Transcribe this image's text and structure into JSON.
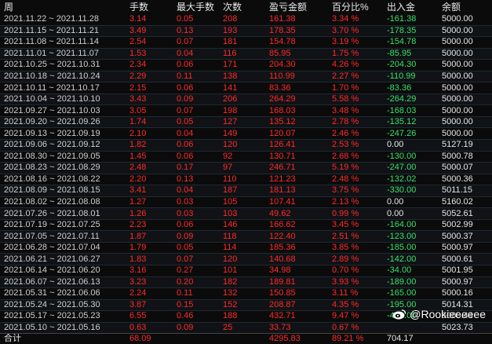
{
  "header": {
    "period": "周",
    "lots": "手数",
    "max_lots": "最大手数",
    "trades": "次数",
    "pnl": "盈亏金额",
    "pct": "百分比%",
    "flow": "出入金",
    "balance": "余额"
  },
  "rows": [
    {
      "period": "2021.11.22 ~ 2021.11.28",
      "lots": "3.14",
      "max_lots": "0.05",
      "trades": "208",
      "pnl": "161.38",
      "pct": "3.34 %",
      "flow": "-161.38",
      "balance": "5000.00"
    },
    {
      "period": "2021.11.15 ~ 2021.11.21",
      "lots": "3.49",
      "max_lots": "0.13",
      "trades": "193",
      "pnl": "178.35",
      "pct": "3.70 %",
      "flow": "-178.35",
      "balance": "5000.00"
    },
    {
      "period": "2021.11.08 ~ 2021.11.14",
      "lots": "2.54",
      "max_lots": "0.07",
      "trades": "181",
      "pnl": "154.78",
      "pct": "3.19 %",
      "flow": "-154.78",
      "balance": "5000.00"
    },
    {
      "period": "2021.11.01 ~ 2021.11.07",
      "lots": "1.53",
      "max_lots": "0.04",
      "trades": "116",
      "pnl": "85.95",
      "pct": "1.75 %",
      "flow": "-85.95",
      "balance": "5000.00"
    },
    {
      "period": "2021.10.25 ~ 2021.10.31",
      "lots": "2.34",
      "max_lots": "0.06",
      "trades": "171",
      "pnl": "204.30",
      "pct": "4.26 %",
      "flow": "-204.30",
      "balance": "5000.00"
    },
    {
      "period": "2021.10.18 ~ 2021.10.24",
      "lots": "2.29",
      "max_lots": "0.11",
      "trades": "138",
      "pnl": "110.99",
      "pct": "2.27 %",
      "flow": "-110.99",
      "balance": "5000.00"
    },
    {
      "period": "2021.10.11 ~ 2021.10.17",
      "lots": "2.15",
      "max_lots": "0.06",
      "trades": "141",
      "pnl": "83.36",
      "pct": "1.70 %",
      "flow": "-83.36",
      "balance": "5000.00"
    },
    {
      "period": "2021.10.04 ~ 2021.10.10",
      "lots": "3.43",
      "max_lots": "0.09",
      "trades": "206",
      "pnl": "264.29",
      "pct": "5.58 %",
      "flow": "-264.29",
      "balance": "5000.00"
    },
    {
      "period": "2021.09.27 ~ 2021.10.03",
      "lots": "3.05",
      "max_lots": "0.07",
      "trades": "198",
      "pnl": "168.03",
      "pct": "3.48 %",
      "flow": "-168.03",
      "balance": "5000.00"
    },
    {
      "period": "2021.09.20 ~ 2021.09.26",
      "lots": "1.74",
      "max_lots": "0.05",
      "trades": "127",
      "pnl": "135.12",
      "pct": "2.78 %",
      "flow": "-135.12",
      "balance": "5000.00"
    },
    {
      "period": "2021.09.13 ~ 2021.09.19",
      "lots": "2.10",
      "max_lots": "0.04",
      "trades": "149",
      "pnl": "120.07",
      "pct": "2.46 %",
      "flow": "-247.26",
      "balance": "5000.00"
    },
    {
      "period": "2021.09.06 ~ 2021.09.12",
      "lots": "1.82",
      "max_lots": "0.06",
      "trades": "120",
      "pnl": "126.41",
      "pct": "2.53 %",
      "flow": "0.00",
      "balance": "5127.19"
    },
    {
      "period": "2021.08.30 ~ 2021.09.05",
      "lots": "1.45",
      "max_lots": "0.06",
      "trades": "92",
      "pnl": "130.71",
      "pct": "2.68 %",
      "flow": "-130.00",
      "balance": "5000.78"
    },
    {
      "period": "2021.08.23 ~ 2021.08.29",
      "lots": "2.48",
      "max_lots": "0.17",
      "trades": "97",
      "pnl": "246.71",
      "pct": "5.19 %",
      "flow": "-247.00",
      "balance": "5000.07"
    },
    {
      "period": "2021.08.16 ~ 2021.08.22",
      "lots": "2.20",
      "max_lots": "0.13",
      "trades": "110",
      "pnl": "121.23",
      "pct": "2.48 %",
      "flow": "-132.02",
      "balance": "5000.36"
    },
    {
      "period": "2021.08.09 ~ 2021.08.15",
      "lots": "3.41",
      "max_lots": "0.04",
      "trades": "187",
      "pnl": "181.13",
      "pct": "3.75 %",
      "flow": "-330.00",
      "balance": "5011.15"
    },
    {
      "period": "2021.08.02 ~ 2021.08.08",
      "lots": "1.27",
      "max_lots": "0.03",
      "trades": "105",
      "pnl": "107.41",
      "pct": "2.13 %",
      "flow": "0.00",
      "balance": "5160.02"
    },
    {
      "period": "2021.07.26 ~ 2021.08.01",
      "lots": "1.26",
      "max_lots": "0.03",
      "trades": "103",
      "pnl": "49.62",
      "pct": "0.99 %",
      "flow": "0.00",
      "balance": "5052.61"
    },
    {
      "period": "2021.07.19 ~ 2021.07.25",
      "lots": "2.23",
      "max_lots": "0.06",
      "trades": "146",
      "pnl": "166.62",
      "pct": "3.45 %",
      "flow": "-164.00",
      "balance": "5002.99"
    },
    {
      "period": "2021.07.05 ~ 2021.07.11",
      "lots": "1.87",
      "max_lots": "0.09",
      "trades": "118",
      "pnl": "122.40",
      "pct": "2.51 %",
      "flow": "-123.00",
      "balance": "5000.37"
    },
    {
      "period": "2021.06.28 ~ 2021.07.04",
      "lots": "1.79",
      "max_lots": "0.05",
      "trades": "114",
      "pnl": "185.36",
      "pct": "3.85 %",
      "flow": "-185.00",
      "balance": "5000.97"
    },
    {
      "period": "2021.06.21 ~ 2021.06.27",
      "lots": "1.83",
      "max_lots": "0.07",
      "trades": "120",
      "pnl": "140.68",
      "pct": "2.89 %",
      "flow": "-142.00",
      "balance": "5000.61"
    },
    {
      "period": "2021.06.14 ~ 2021.06.20",
      "lots": "3.16",
      "max_lots": "0.27",
      "trades": "101",
      "pnl": "34.98",
      "pct": "0.70 %",
      "flow": "-34.00",
      "balance": "5001.95"
    },
    {
      "period": "2021.06.07 ~ 2021.06.13",
      "lots": "3.23",
      "max_lots": "0.20",
      "trades": "182",
      "pnl": "189.81",
      "pct": "3.93 %",
      "flow": "-189.00",
      "balance": "5000.97"
    },
    {
      "period": "2021.05.31 ~ 2021.06.06",
      "lots": "2.24",
      "max_lots": "0.11",
      "trades": "132",
      "pnl": "150.85",
      "pct": "3.11 %",
      "flow": "-165.00",
      "balance": "5000.16"
    },
    {
      "period": "2021.05.24 ~ 2021.05.30",
      "lots": "3.87",
      "max_lots": "0.15",
      "trades": "152",
      "pnl": "208.87",
      "pct": "4.35 %",
      "flow": "-195.00",
      "balance": "5014.31"
    },
    {
      "period": "2021.05.17 ~ 2021.05.23",
      "lots": "6.55",
      "max_lots": "0.46",
      "trades": "188",
      "pnl": "432.71",
      "pct": "9.47 %",
      "flow": "-456.00",
      "balance": "5000.44"
    },
    {
      "period": "2021.05.10 ~ 2021.05.16",
      "lots": "0.63",
      "max_lots": "0.09",
      "trades": "25",
      "pnl": "33.73",
      "pct": "0.67 %",
      "flow": "",
      "balance": "5023.73"
    }
  ],
  "footer": {
    "label": "合计",
    "lots": "68.09",
    "pnl": "4295.83",
    "pct": "89.21 %",
    "flow": "704.17"
  },
  "watermark": {
    "text": "@Rookieeeeee",
    "icon": "weibo-icon"
  },
  "colors": {
    "positive": "#ff2a2a",
    "negative": "#39e16b",
    "neutral": "#e6e6e6",
    "background": "#0b0b0b"
  }
}
